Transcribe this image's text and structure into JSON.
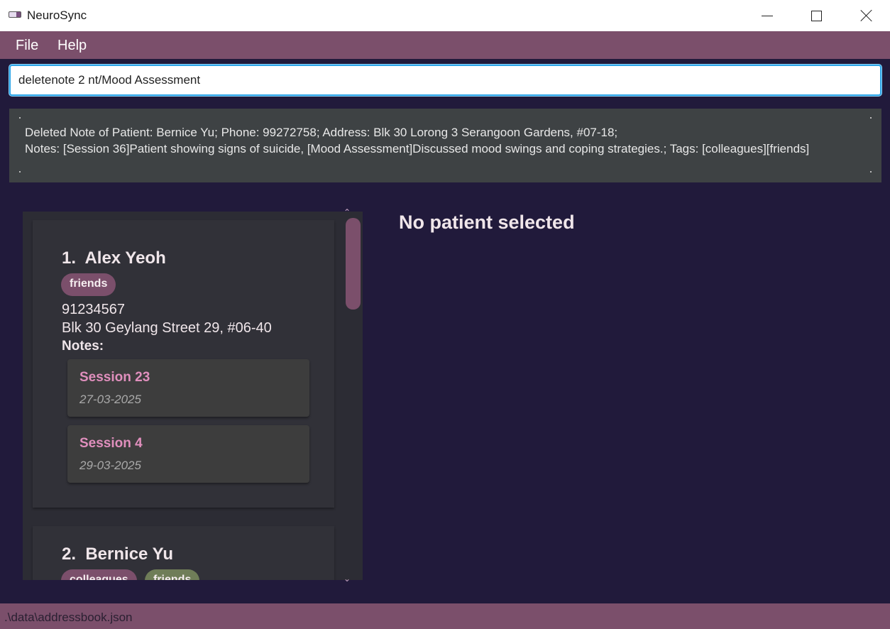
{
  "window": {
    "title": "NeuroSync",
    "icon": "app-battery-icon"
  },
  "menu": {
    "file": "File",
    "help": "Help"
  },
  "command": {
    "value": "deletenote 2 nt/Mood Assessment"
  },
  "result": {
    "line1": "Deleted Note of Patient: Bernice Yu; Phone: 99272758; Address: Blk 30 Lorong 3 Serangoon Gardens, #07-18;",
    "line2": "Notes: [Session 36]Patient showing signs of suicide, [Mood Assessment]Discussed mood swings and coping strategies.; Tags: [colleagues][friends]"
  },
  "patients": [
    {
      "index_name": "1.  Alex Yeoh",
      "tags": [
        "friends"
      ],
      "phone": "91234567",
      "address": "Blk 30 Geylang Street 29, #06-40",
      "notes_label": "Notes:",
      "notes": [
        {
          "title": "Session 23",
          "date": "27-03-2025"
        },
        {
          "title": "Session 4",
          "date": "29-03-2025"
        }
      ]
    },
    {
      "index_name": "2.  Bernice Yu",
      "tags": [
        "colleagues",
        "friends"
      ]
    }
  ],
  "detail": {
    "title": "No patient selected"
  },
  "status": {
    "path": ".\\data\\addressbook.json"
  },
  "colors": {
    "accent": "#7b4f6b",
    "background": "#211a3b",
    "note_title": "#e08fbd",
    "tag_green": "#6f7d58",
    "focus_border": "#2ea6e8"
  }
}
